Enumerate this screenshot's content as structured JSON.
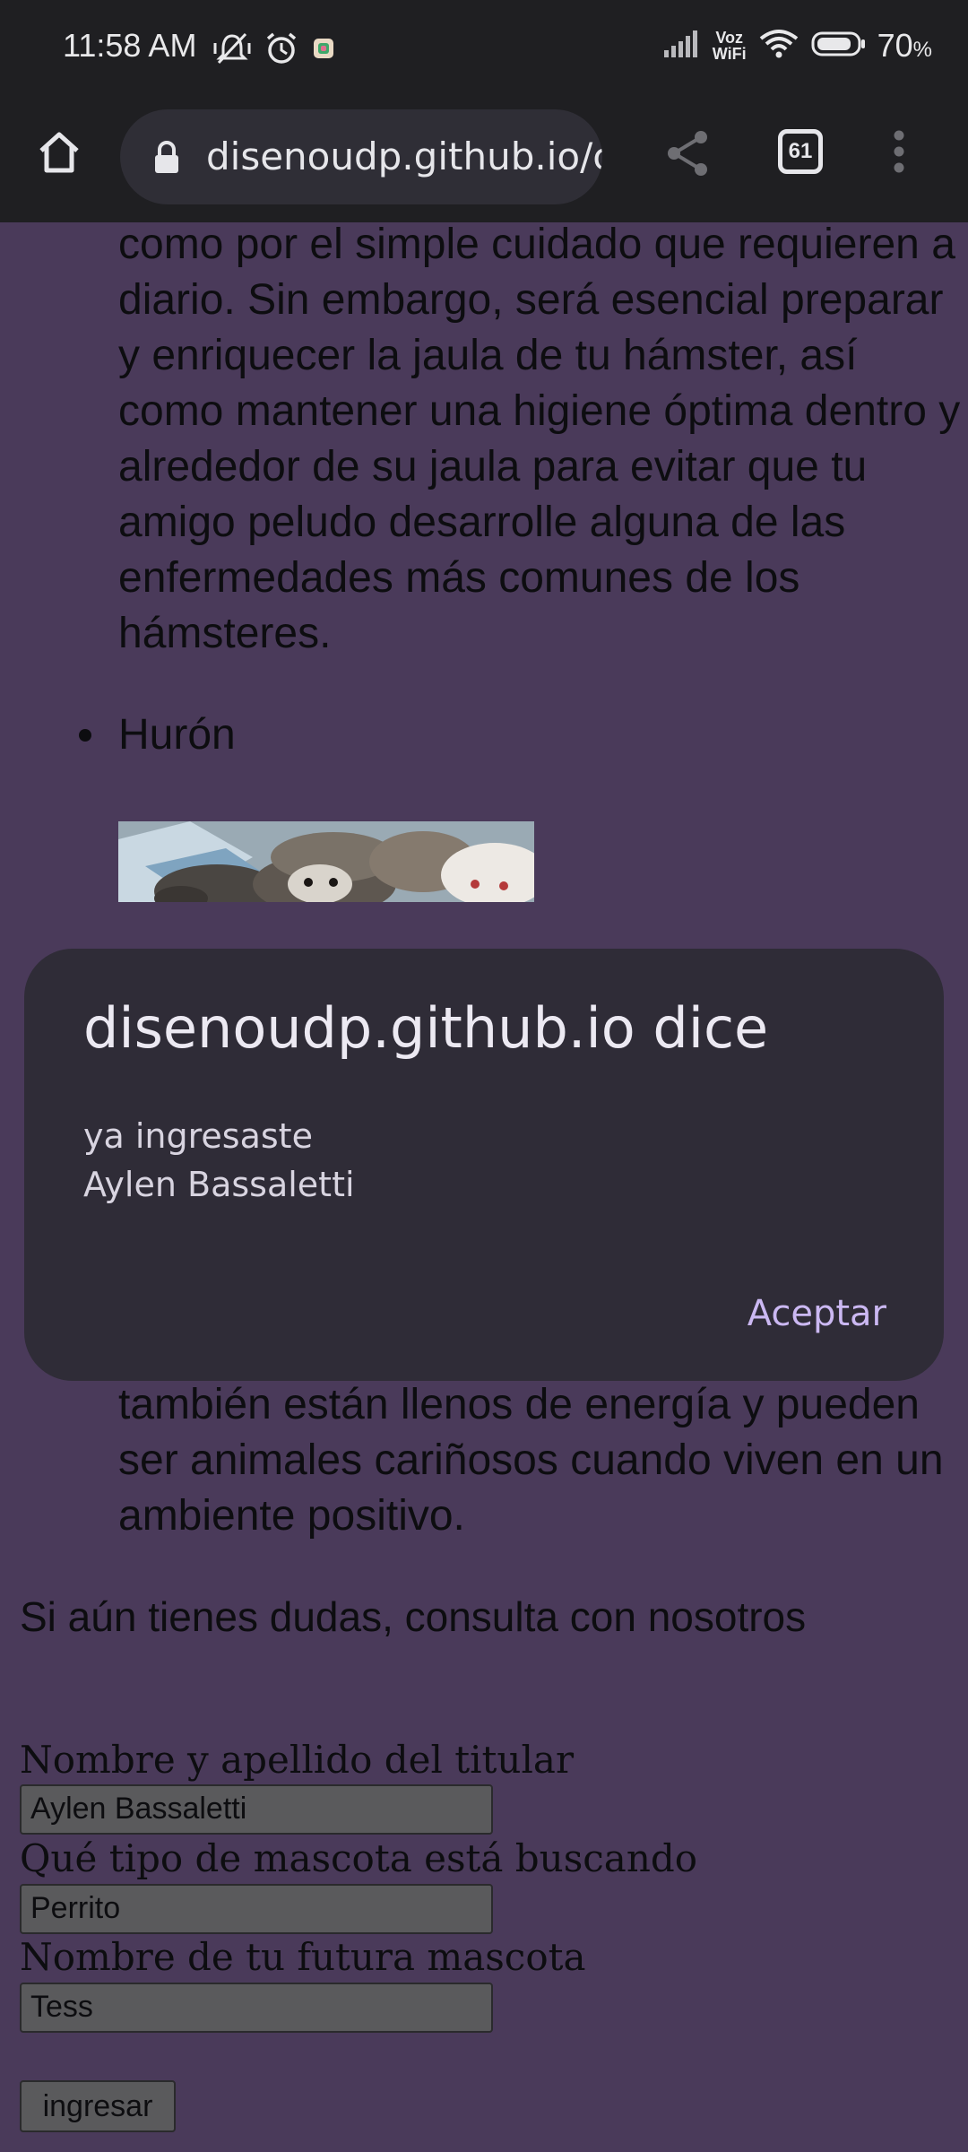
{
  "status_bar": {
    "time": "11:58 AM",
    "battery_percent": "70",
    "battery_unit": "%",
    "voz_wifi": [
      "Voz",
      "WiFi"
    ],
    "icons": [
      "vibrate-off-icon",
      "alarm-icon",
      "app-notification-icon",
      "signal-icon",
      "wifi-icon",
      "battery-icon"
    ]
  },
  "toolbar": {
    "url": "disenoudp.github.io/c",
    "tab_count": "61",
    "icons": [
      "home-icon",
      "lock-icon",
      "share-icon",
      "tabs-icon",
      "more-vert-icon"
    ]
  },
  "content": {
    "paragraph_top": "como por el simple cuidado que requieren a diario. Sin embargo, será esencial preparar y enriquecer la jaula de tu hámster, así como mantener una higiene óptima dentro y alrededor de su jaula para evitar que tu amigo peludo desarrolle alguna de las enfermedades más comunes de los hámsteres.",
    "bullet_label": "Hurón",
    "paragraph_bottom": "también están llenos de energía y pueden ser animales cariñosos cuando viven en un ambiente positivo.",
    "consulta": "Si aún tienes dudas, consulta con nosotros"
  },
  "form": {
    "fields": [
      {
        "label": "Nombre y apellido del titular",
        "value": "Aylen Bassaletti"
      },
      {
        "label": "Qué tipo de mascota está buscando",
        "value": "Perrito"
      },
      {
        "label": "Nombre de tu futura mascota",
        "value": "Tess"
      }
    ],
    "submit_label": "ingresar"
  },
  "dialog": {
    "title": "disenoudp.github.io dice",
    "message": "ya ingresaste\nAylen Bassaletti",
    "ok_label": "Aceptar"
  },
  "colors": {
    "page_background": "#4a3a5a",
    "chrome_background": "#1f1f22",
    "dialog_background": "#2f2c37",
    "dialog_accent": "#cbb8f2"
  }
}
